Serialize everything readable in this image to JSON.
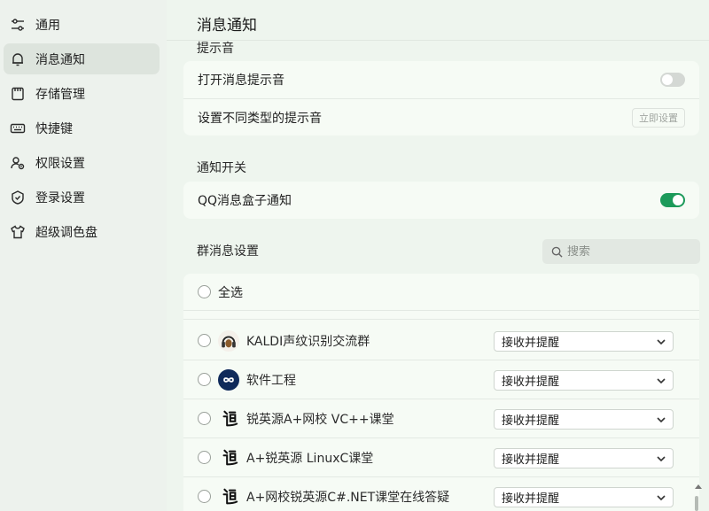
{
  "sidebar": {
    "items": [
      {
        "label": "通用",
        "icon": "sliders-icon"
      },
      {
        "label": "消息通知",
        "icon": "bell-icon",
        "active": true
      },
      {
        "label": "存储管理",
        "icon": "storage-icon"
      },
      {
        "label": "快捷键",
        "icon": "keyboard-icon"
      },
      {
        "label": "权限设置",
        "icon": "user-permission-icon"
      },
      {
        "label": "登录设置",
        "icon": "shield-icon"
      },
      {
        "label": "超级调色盘",
        "icon": "shirt-icon"
      }
    ]
  },
  "main": {
    "title": "消息通知",
    "sound_section": {
      "title": "提示音",
      "enable_sound_label": "打开消息提示音",
      "enable_sound_on": false,
      "type_sound_label": "设置不同类型的提示音",
      "type_sound_button": "立即设置"
    },
    "notify_section": {
      "title": "通知开关",
      "box_notify_label": "QQ消息盒子通知",
      "box_notify_on": true
    },
    "group_section": {
      "title": "群消息设置",
      "search_placeholder": "搜索",
      "select_all_label": "全选",
      "groups": [
        {
          "name": "KALDI声纹识别交流群",
          "setting": "接收并提醒",
          "avatar": "headphone-avatar-icon"
        },
        {
          "name": "软件工程",
          "setting": "接收并提醒",
          "avatar": "infinity-avatar-icon"
        },
        {
          "name": "锐英源A+网校 VC++课堂",
          "setting": "接收并提醒",
          "avatar": "dao-calligraphy-avatar-icon"
        },
        {
          "name": "A+锐英源 LinuxC课堂",
          "setting": "接收并提醒",
          "avatar": "dao-calligraphy-avatar-icon"
        },
        {
          "name": "A+网校锐英源C#.NET课堂在线答疑",
          "setting": "接收并提醒",
          "avatar": "dao-calligraphy-avatar-icon"
        }
      ]
    }
  },
  "colors": {
    "accent_green": "#1c9a5a",
    "toggle_off": "#d4d8d4",
    "card_bg": "#f6fbf5",
    "page_bg": "#eef5ee"
  }
}
